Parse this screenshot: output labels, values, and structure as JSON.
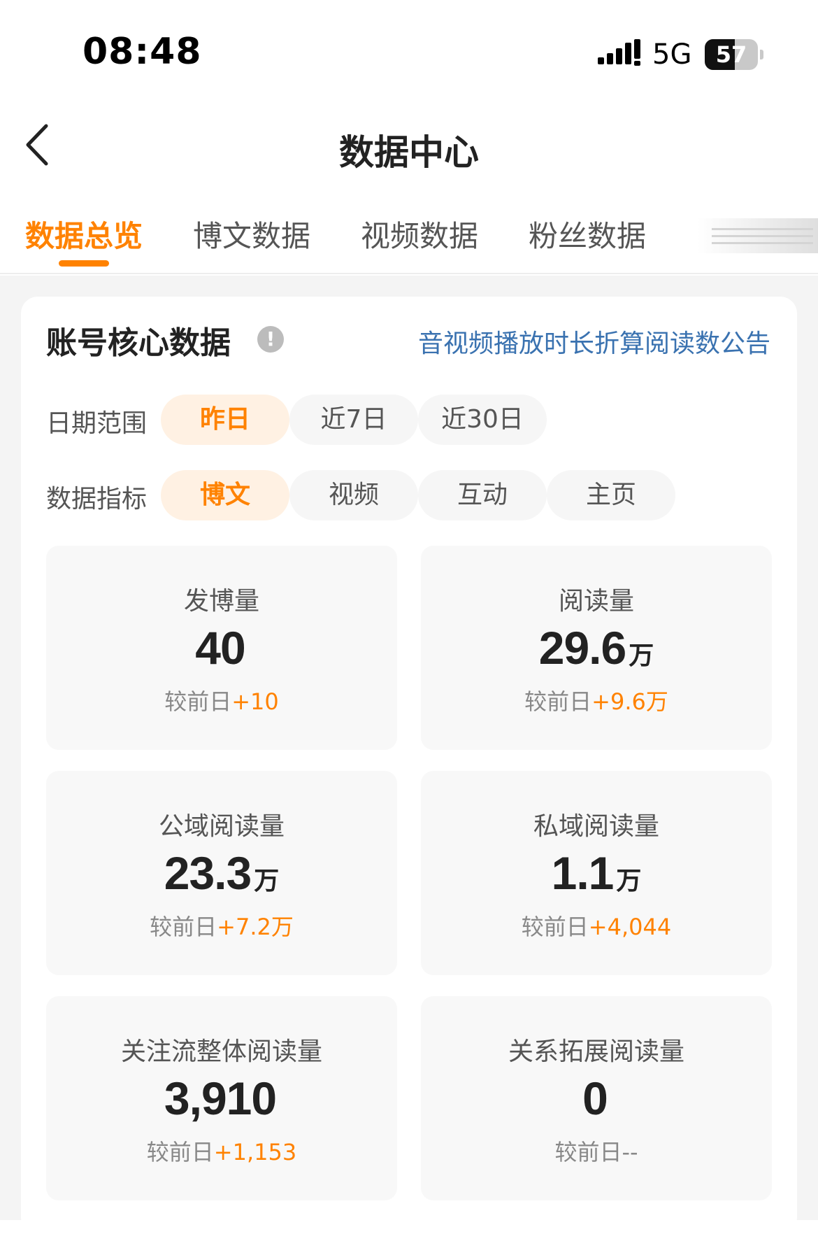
{
  "status_bar": {
    "time": "08:48",
    "network": "5G",
    "battery_level": 57,
    "battery_label": "57"
  },
  "nav": {
    "title": "数据中心"
  },
  "tabs": [
    {
      "label": "数据总览",
      "active": true
    },
    {
      "label": "博文数据",
      "active": false
    },
    {
      "label": "视频数据",
      "active": false
    },
    {
      "label": "粉丝数据",
      "active": false
    }
  ],
  "card": {
    "title": "账号核心数据",
    "info_icon": "!",
    "notice_link": "音视频播放时长折算阅读数公告"
  },
  "filters": {
    "date_range": {
      "label": "日期范围",
      "options": [
        "昨日",
        "近7日",
        "近30日"
      ],
      "selected": "昨日"
    },
    "metric_type": {
      "label": "数据指标",
      "options": [
        "博文",
        "视频",
        "互动",
        "主页"
      ],
      "selected": "博文"
    }
  },
  "compare_label": "较前日",
  "metrics": [
    {
      "label": "发博量",
      "value": "40",
      "unit": "",
      "delta": "+10"
    },
    {
      "label": "阅读量",
      "value": "29.6",
      "unit": "万",
      "delta": "+9.6万"
    },
    {
      "label": "公域阅读量",
      "value": "23.3",
      "unit": "万",
      "delta": "+7.2万"
    },
    {
      "label": "私域阅读量",
      "value": "1.1",
      "unit": "万",
      "delta": "+4,044"
    },
    {
      "label": "关注流整体阅读量",
      "value": "3,910",
      "unit": "",
      "delta": "+1,153"
    },
    {
      "label": "关系拓展阅读量",
      "value": "0",
      "unit": "",
      "delta": "--"
    }
  ],
  "colors": {
    "accent": "#ff8200",
    "link": "#3a72b0",
    "chip_active_bg": "#fff1e3"
  }
}
